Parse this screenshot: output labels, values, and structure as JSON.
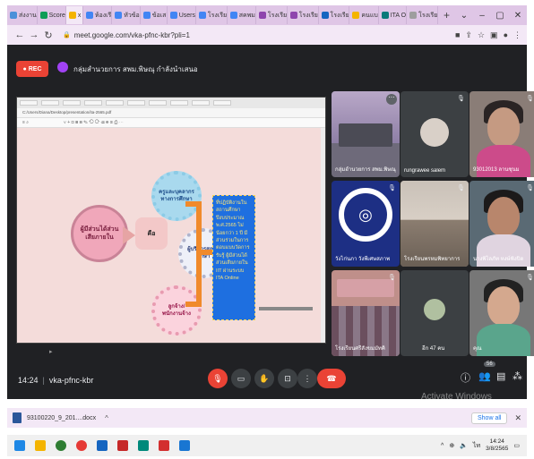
{
  "browser": {
    "tabs": [
      {
        "label": "ส่งงาน",
        "color": "#4a90d9"
      },
      {
        "label": "Score",
        "color": "#0f9d58"
      },
      {
        "label": "x",
        "color": "#f4b400",
        "active": true
      },
      {
        "label": "ห้องเรี",
        "color": "#4285f4"
      },
      {
        "label": "หัวข้อ",
        "color": "#4285f4"
      },
      {
        "label": "ข้อเส",
        "color": "#4285f4"
      },
      {
        "label": "Users",
        "color": "#4285f4"
      },
      {
        "label": "โรงเรีย",
        "color": "#4285f4"
      },
      {
        "label": "สคพม",
        "color": "#4285f4"
      },
      {
        "label": "โรงเรีย",
        "color": "#8e44ad"
      },
      {
        "label": "โรงเรีย",
        "color": "#8e44ad"
      },
      {
        "label": "โรงเรีย",
        "color": "#1565c0"
      },
      {
        "label": "คนแบ",
        "color": "#f4b400"
      },
      {
        "label": "ITA O",
        "color": "#0a7a7a"
      },
      {
        "label": "โรงเรีย",
        "color": "#9e9e9e"
      }
    ],
    "url": "meet.google.com/vka-pfnc-kbr?pli=1"
  },
  "meet": {
    "rec_label": "REC",
    "meeting_title": "กลุ่มสำนวยการ สพม.พิษณุ กำลังนำเสนอ",
    "time": "14:24",
    "meeting_code": "vka-pfnc-kbr",
    "people_count": "56"
  },
  "slide": {
    "left_node": "ผู้มีส่วนได้ส่วนเสียภายใน",
    "yes_node": "คือ",
    "gear_1": "ครูและบุคลากรทางการศึกษา",
    "gear_2": "ผู้บริหารสถานศึกษา",
    "gear_3": "ลูกจ้าง/พนักงานจ้าง",
    "blue_box": "ที่ปฏิบัติงานในสถานศึกษาปีงบประมาณ พ.ศ.2565 ไม่น้อยกว่า 1 ปี มีส่วนร่วมในการตอบแบบวัดการรับรู้ ผู้มีส่วนได้ส่วนเสียภายใน IIT ผ่านระบบ ITA Online",
    "share_url": "C:/Users/Diana/Desktop/presentation/ita-2565.pdf"
  },
  "tiles": [
    {
      "name": "กลุ่มอำนวยการ สพม.พิษณุ"
    },
    {
      "name": "rungrawee salem"
    },
    {
      "name": "93012013 ลานซุนม"
    },
    {
      "name": "วังไก่นภา วังพีเศษสภาพ"
    },
    {
      "name": "โรงเรียนพรหมพิทยาการ"
    },
    {
      "name": "นางพิไลภัท หงษ์ฟังปิด"
    },
    {
      "name": "โรงเรียนศรีสังขมมัทคิ"
    },
    {
      "name": "อีก 47 คน"
    },
    {
      "name": "คุณ"
    }
  ],
  "watermark": {
    "line1": "Activate Windows",
    "line2": "Go to Settings to activate Windows."
  },
  "downloads": {
    "file": "93100220_9_201....docx",
    "show_all": "Show all"
  },
  "clock": {
    "time": "14:24",
    "date": "3/8/2565"
  }
}
